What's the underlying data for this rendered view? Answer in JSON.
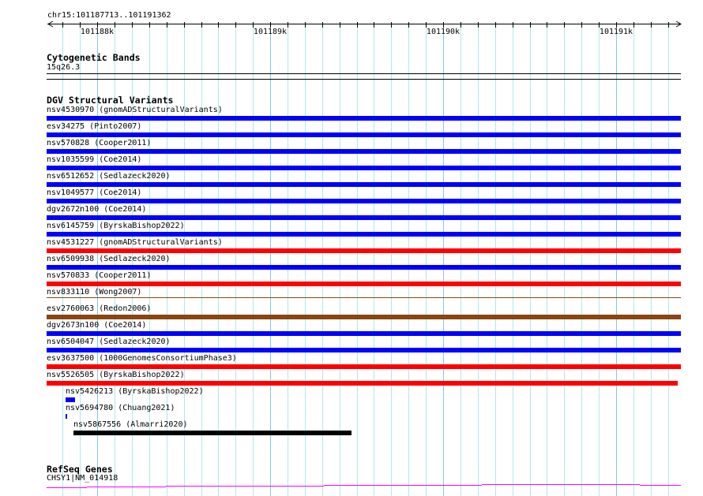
{
  "location": "chr15:101187713..101191362",
  "ruler": {
    "ticks": [
      "101188k",
      "101189k",
      "101190k",
      "101191k"
    ]
  },
  "cytoband_track": {
    "title": "Cytogenetic Bands",
    "band": "15q26.3"
  },
  "dgv_track": {
    "title": "DGV Structural Variants",
    "colors": {
      "blue": "#0000ff",
      "red": "#ff0000",
      "brown": "#8b4513",
      "black": "#000000"
    },
    "rows": [
      {
        "label": "nsv4530970 (gnomADStructuralVariants)",
        "color": "blue"
      },
      {
        "label": "esv34275 (Pinto2007)",
        "color": "blue"
      },
      {
        "label": "nsv570828 (Cooper2011)",
        "color": "blue"
      },
      {
        "label": "nsv1035599 (Coe2014)",
        "color": "blue"
      },
      {
        "label": "nsv6512652 (Sedlazeck2020)",
        "color": "blue"
      },
      {
        "label": "nsv1049577 (Coe2014)",
        "color": "blue"
      },
      {
        "label": "dgv2672n100 (Coe2014)",
        "color": "blue"
      },
      {
        "label": "nsv6145759 (ByrskaBishop2022)",
        "color": "blue"
      },
      {
        "label": "nsv4531227 (gnomADStructuralVariants)",
        "color": "red"
      },
      {
        "label": "nsv6509938 (Sedlazeck2020)",
        "color": "blue"
      },
      {
        "label": "nsv570833 (Cooper2011)",
        "color": "red"
      },
      {
        "label": "nsv833110 (Wong2007)",
        "color": "brown",
        "thin": true
      },
      {
        "label": "esv2760063 (Redon2006)",
        "color": "brown"
      },
      {
        "label": "dgv2673n100 (Coe2014)",
        "color": "blue"
      },
      {
        "label": "nsv6504047 (Sedlazeck2020)",
        "color": "blue"
      },
      {
        "label": "esv3637500 (1000GenomesConsortiumPhase3)",
        "color": "red"
      },
      {
        "label": "nsv5526505 (ByrskaBishop2022)",
        "color": "red",
        "short": true
      }
    ],
    "small_rows": [
      {
        "label": "nsv5426213 (ByrskaBishop2022)",
        "color": "blue"
      },
      {
        "label": "nsv5694780 (Chuang2021)",
        "color": "blue"
      },
      {
        "label": "nsv5867556 (Almarri2020)",
        "color": "black"
      }
    ]
  },
  "refseq_track": {
    "title": "RefSeq Genes",
    "gene": "CHSY1|NM_014918",
    "color": "#ff00ff"
  }
}
